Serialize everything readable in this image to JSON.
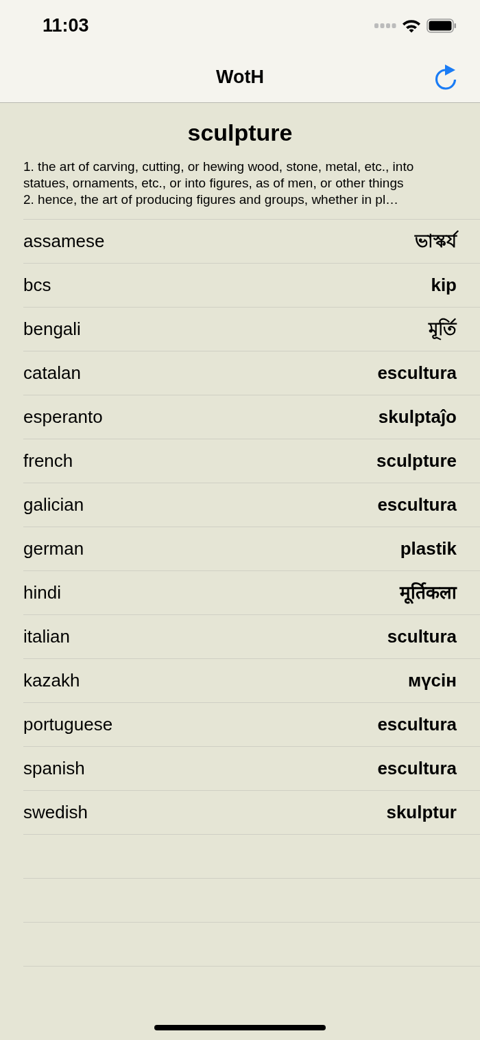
{
  "status_bar": {
    "time": "11:03"
  },
  "nav": {
    "title": "WotH"
  },
  "word": {
    "title": "sculpture",
    "definition": "1. the art of carving, cutting, or hewing wood, stone, metal, etc., into statues, ornaments, etc., or into figures, as of men, or other things\n2. hence, the art of producing figures and groups, whether in pl…"
  },
  "translations": [
    {
      "language": "assamese",
      "translation": "ভাস্কৰ্য"
    },
    {
      "language": "bcs",
      "translation": "kip"
    },
    {
      "language": "bengali",
      "translation": "মূর্তি"
    },
    {
      "language": "catalan",
      "translation": "escultura"
    },
    {
      "language": "esperanto",
      "translation": "skulptaĵo"
    },
    {
      "language": "french",
      "translation": "sculpture"
    },
    {
      "language": "galician",
      "translation": "escultura"
    },
    {
      "language": "german",
      "translation": "plastik"
    },
    {
      "language": "hindi",
      "translation": "मूर्तिकला"
    },
    {
      "language": "italian",
      "translation": "scultura"
    },
    {
      "language": "kazakh",
      "translation": "мүсін"
    },
    {
      "language": "portuguese",
      "translation": "escultura"
    },
    {
      "language": "spanish",
      "translation": "escultura"
    },
    {
      "language": "swedish",
      "translation": "skulptur"
    }
  ]
}
